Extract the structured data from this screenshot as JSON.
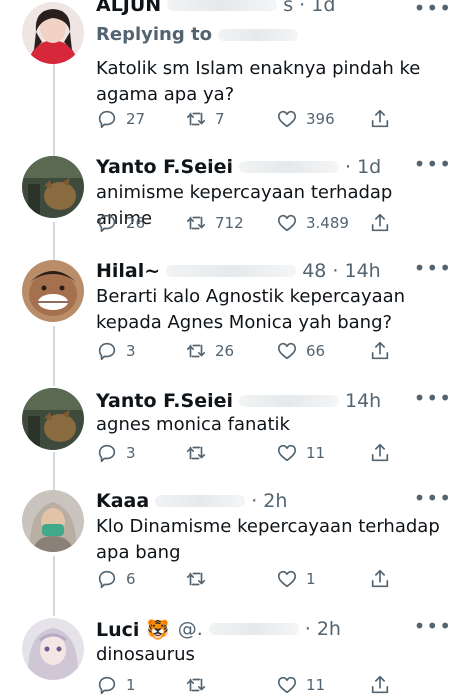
{
  "tweets": [
    {
      "name": "ALJUN",
      "time": "s · 1d",
      "reply_label": "Replying to",
      "text": "Katolik sm Islam enaknya pindah ke agama apa ya?",
      "replies": "27",
      "retweets": "7",
      "likes": "396"
    },
    {
      "name": "Yanto F.Seiei",
      "time": "· 1d",
      "text": "animisme kepercayaan terhadap anime",
      "replies": "26",
      "retweets": "712",
      "likes": "3.489"
    },
    {
      "name": "Hilal~",
      "time": "48 · 14h",
      "text": "Berarti kalo Agnostik kepercayaan kepada Agnes Monica yah bang?",
      "replies": "3",
      "retweets": "26",
      "likes": "66"
    },
    {
      "name": "Yanto F.Seiei",
      "time": "14h",
      "text": "agnes monica fanatik",
      "replies": "3",
      "retweets": "",
      "likes": "11"
    },
    {
      "name": "Kaaa",
      "time": "· 2h",
      "text": "Klo Dinamisme kepercayaan terhadap apa bang",
      "replies": "6",
      "retweets": "",
      "likes": "1"
    },
    {
      "name": "Luci 🐯",
      "handle": "@.",
      "time": "· 2h",
      "text": "dinosaurus",
      "replies": "1",
      "retweets": "",
      "likes": "11"
    }
  ],
  "more_label": "•••"
}
